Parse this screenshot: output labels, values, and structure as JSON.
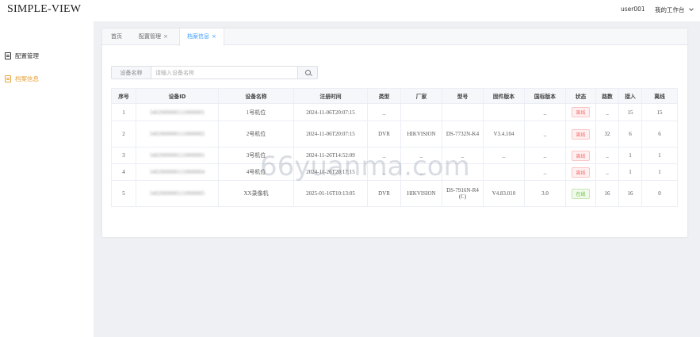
{
  "app": {
    "title": "SIMPLE-VIEW"
  },
  "header": {
    "username": "user001",
    "workspace": "我的工作台"
  },
  "sidebar": {
    "items": [
      {
        "label": "配置管理",
        "icon": "document-icon"
      },
      {
        "label": "档案信息",
        "icon": "document-icon",
        "active": true,
        "color": "#e6a23c"
      }
    ]
  },
  "tabs": [
    {
      "label": "首页"
    },
    {
      "label": "配置管理",
      "close": "×"
    },
    {
      "label": "档案信息",
      "close": "×",
      "active": true
    }
  ],
  "search": {
    "label": "设备名称",
    "placeholder": "请输入设备名称",
    "value": ""
  },
  "table": {
    "columns": [
      "序号",
      "设备ID",
      "设备名称",
      "注册时间",
      "类型",
      "厂家",
      "型号",
      "固件版本",
      "国标版本",
      "状态",
      "路数",
      "接入",
      "离线"
    ],
    "rows": [
      [
        "1",
        "34020000001110000001",
        "1号机位",
        "2024-11-06T20:07:15",
        "_",
        "",
        "",
        "",
        "_",
        "离线",
        "_",
        "15",
        "15"
      ],
      [
        "2",
        "34020000001110000002",
        "2号机位",
        "2024-11-06T20:07:15",
        "DVR",
        "HIKVISION",
        "DS-7732N-K4",
        "V3.4.104",
        "_",
        "离线",
        "32",
        "6",
        "6"
      ],
      [
        "3",
        "34020000001110000001",
        "3号机位",
        "2024-11-26T14:52:09",
        "_",
        "_",
        "_",
        "_",
        "_",
        "离线",
        "_",
        "1",
        "1"
      ],
      [
        "4",
        "34020000001110000004",
        "4号机位",
        "2024-11-26T20:17:15",
        "_",
        "_",
        "",
        "",
        "_",
        "离线",
        "_",
        "1",
        "1"
      ],
      [
        "5",
        "34020000001110000005",
        "XX录像机",
        "2025-01-16T10:13:05",
        "DVR",
        "HIKVISION",
        "DS-7916N-R4(C)",
        "V4.83.010",
        "3.0",
        "在线",
        "16",
        "16",
        "0"
      ]
    ]
  },
  "watermark": "66yuanma.com"
}
